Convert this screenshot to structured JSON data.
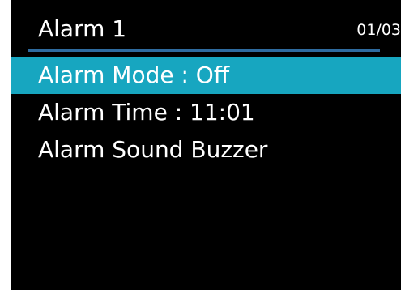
{
  "header": {
    "title": "Alarm 1",
    "page_counter": "01/03"
  },
  "menu": {
    "selected_index": 0,
    "items": [
      {
        "label": "Alarm Mode : Off"
      },
      {
        "label": "Alarm Time : 11:01"
      },
      {
        "label": "Alarm Sound Buzzer"
      }
    ]
  },
  "colors": {
    "background": "#000000",
    "text": "#ffffff",
    "highlight": "#17a6c0",
    "divider": "#2e6b9f"
  }
}
